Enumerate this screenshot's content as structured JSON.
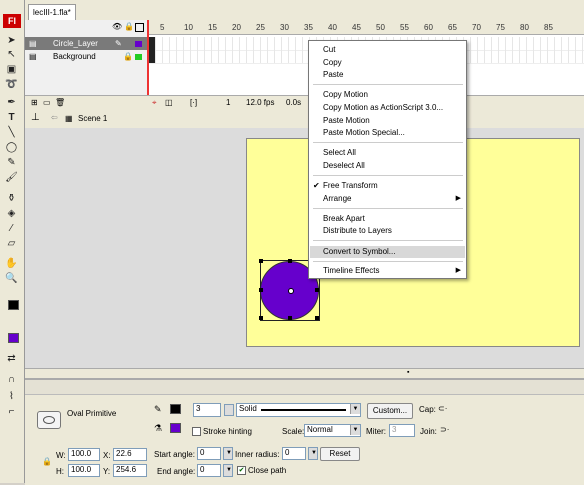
{
  "app": {
    "logo": "Fl"
  },
  "document": {
    "tab_label": "lecIII-1.fla*"
  },
  "timeline": {
    "frame_numbers": [
      "5",
      "10",
      "15",
      "20",
      "25",
      "30",
      "35",
      "40",
      "45",
      "50",
      "55",
      "60",
      "65",
      "70",
      "75",
      "80",
      "85"
    ],
    "layers": [
      {
        "name": "Circle_Layer",
        "selected": true
      },
      {
        "name": "Background",
        "selected": false
      }
    ],
    "status": {
      "frame": "1",
      "fps": "12.0 fps",
      "time": "0.0s"
    }
  },
  "editbar": {
    "scene": "Scene 1"
  },
  "context_menu": {
    "items": [
      {
        "label": "Cut"
      },
      {
        "label": "Copy"
      },
      {
        "label": "Paste"
      },
      {
        "label": "Copy Motion"
      },
      {
        "label": "Copy Motion as ActionScript 3.0..."
      },
      {
        "label": "Paste Motion"
      },
      {
        "label": "Paste Motion Special..."
      },
      {
        "label": "Select All"
      },
      {
        "label": "Deselect All"
      },
      {
        "label": "Free Transform",
        "checked": true
      },
      {
        "label": "Arrange",
        "submenu": true
      },
      {
        "label": "Break Apart"
      },
      {
        "label": "Distribute to Layers"
      },
      {
        "label": "Convert to Symbol...",
        "highlighted": true
      },
      {
        "label": "Timeline Effects",
        "submenu": true
      }
    ]
  },
  "shape": {
    "fill_color": "#6600cc",
    "stage_color": "#ffff99"
  },
  "properties": {
    "type_label": "Oval Primitive",
    "stroke_size": "3",
    "stroke_style": "Solid",
    "custom_button": "Custom...",
    "cap_label": "Cap:",
    "stroke_hinting_label": "Stroke hinting",
    "scale_label": "Scale:",
    "scale_value": "Normal",
    "miter_label": "Miter:",
    "miter_value": "3",
    "join_label": "Join:",
    "w_label": "W:",
    "w_value": "100.0",
    "x_label": "X:",
    "x_value": "22.6",
    "h_label": "H:",
    "h_value": "100.0",
    "y_label": "Y:",
    "y_value": "254.6",
    "start_angle_label": "Start angle:",
    "start_angle_value": "0",
    "end_angle_label": "End angle:",
    "end_angle_value": "0",
    "inner_radius_label": "Inner radius:",
    "inner_radius_value": "0",
    "reset_button": "Reset",
    "close_path_label": "Close path",
    "close_path_checked": true,
    "stroke_color": "#000000",
    "fill_color": "#6600cc"
  }
}
